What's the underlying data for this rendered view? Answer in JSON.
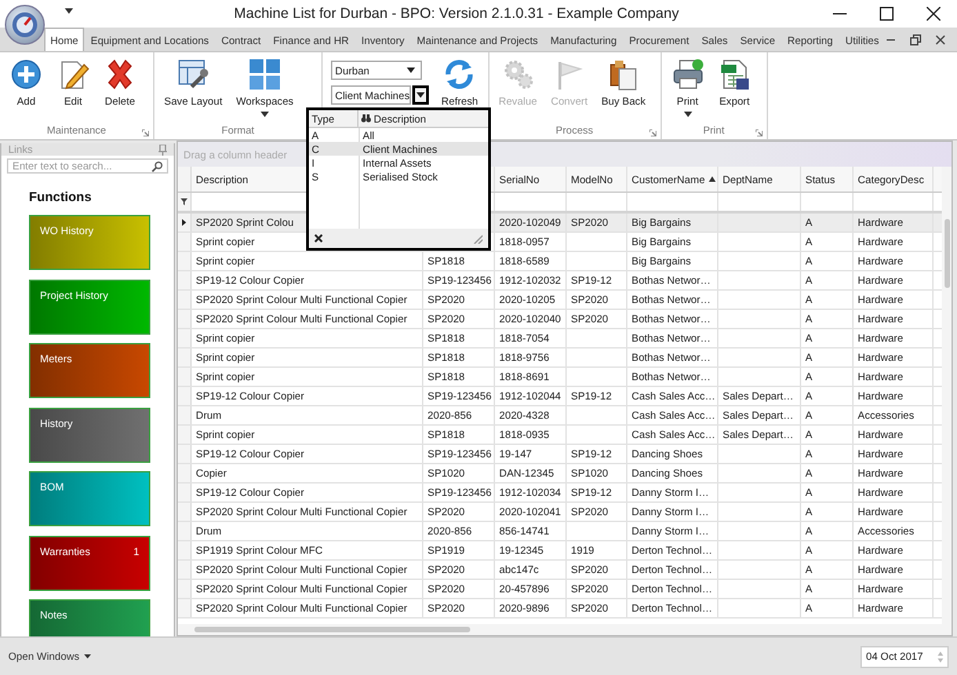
{
  "window": {
    "title": "Machine List for Durban - BPO: Version 2.1.0.31 - Example Company"
  },
  "tabs": [
    {
      "label": "Home",
      "selected": true
    },
    {
      "label": "Equipment and Locations",
      "selected": false
    },
    {
      "label": "Contract",
      "selected": false
    },
    {
      "label": "Finance and HR",
      "selected": false
    },
    {
      "label": "Inventory",
      "selected": false
    },
    {
      "label": "Maintenance and Projects",
      "selected": false
    },
    {
      "label": "Manufacturing",
      "selected": false
    },
    {
      "label": "Procurement",
      "selected": false
    },
    {
      "label": "Sales",
      "selected": false
    },
    {
      "label": "Service",
      "selected": false
    },
    {
      "label": "Reporting",
      "selected": false
    },
    {
      "label": "Utilities",
      "selected": false
    }
  ],
  "ribbon": {
    "groups": [
      {
        "label": "Maintenance",
        "items": [
          {
            "kind": "button",
            "label": "Add",
            "disabled": false
          },
          {
            "kind": "button",
            "label": "Edit",
            "disabled": false
          },
          {
            "kind": "button",
            "label": "Delete",
            "disabled": false
          }
        ]
      },
      {
        "label": "Format",
        "items": [
          {
            "kind": "button",
            "label": "Save Layout",
            "disabled": false
          },
          {
            "kind": "menu_button",
            "label": "Workspaces",
            "disabled": false
          }
        ]
      },
      {
        "items": [
          {
            "kind": "combos",
            "combos": [
              {
                "value": "Durban",
                "open": false
              },
              {
                "value": "Client Machines",
                "open": true
              }
            ]
          },
          {
            "kind": "button",
            "label": "Refresh",
            "disabled": false
          }
        ]
      },
      {
        "label": "Process",
        "items": [
          {
            "kind": "button",
            "label": "Revalue",
            "disabled": true
          },
          {
            "kind": "button",
            "label": "Convert",
            "disabled": true
          },
          {
            "kind": "button",
            "label": "Buy Back",
            "disabled": false
          }
        ]
      },
      {
        "label": "Print",
        "items": [
          {
            "kind": "menu_button",
            "label": "Print",
            "disabled": false
          },
          {
            "kind": "button",
            "label": "Export",
            "disabled": false
          }
        ]
      }
    ]
  },
  "links": {
    "title": "Links",
    "search": {
      "placeholder": "Enter text to search..."
    },
    "heading": "Functions",
    "tiles": [
      {
        "label": "WO History",
        "color": "#c8c000"
      },
      {
        "label": "Project History",
        "color": "#00b800"
      },
      {
        "label": "Meters",
        "color": "#c84800"
      },
      {
        "label": "History",
        "color": "#707070"
      },
      {
        "label": "BOM",
        "color": "#00c0c0"
      },
      {
        "label": "Warranties",
        "color": "#c80000",
        "count": "1"
      },
      {
        "label": "Notes",
        "color": "#20a050"
      }
    ]
  },
  "grid": {
    "group_panel": "Drag a column header",
    "columns": [
      {
        "label": "Description",
        "sorted": false
      },
      {},
      {
        "label": "SerialNo",
        "sorted": false
      },
      {
        "label": "ModelNo",
        "sorted": false
      },
      {
        "label": "CustomerName",
        "sorted": true
      },
      {
        "label": "DeptName",
        "sorted": false
      },
      {
        "label": "Status",
        "sorted": false
      },
      {
        "label": "CategoryDesc",
        "sorted": false
      }
    ],
    "rows": [
      {
        "selected": true,
        "cells": [
          "SP2020 Sprint Colou",
          null,
          "2020-102049",
          "SP2020",
          "Big Bargains",
          null,
          "A",
          "Hardware"
        ]
      },
      {
        "selected": false,
        "cells": [
          "Sprint copier",
          null,
          "1818-0957",
          null,
          "Big Bargains",
          null,
          "A",
          "Hardware"
        ]
      },
      {
        "selected": false,
        "cells": [
          "Sprint copier",
          "SP1818",
          "1818-6589",
          null,
          "Big Bargains",
          null,
          "A",
          "Hardware"
        ]
      },
      {
        "selected": false,
        "cells": [
          "SP19-12 Colour Copier",
          "SP19-123456",
          "1912-102032",
          "SP19-12",
          "Bothas Networ…",
          null,
          "A",
          "Hardware"
        ]
      },
      {
        "selected": false,
        "cells": [
          "SP2020 Sprint Colour Multi Functional Copier",
          "SP2020",
          "2020-10205",
          "SP2020",
          "Bothas Networ…",
          null,
          "A",
          "Hardware"
        ]
      },
      {
        "selected": false,
        "cells": [
          "SP2020 Sprint Colour Multi Functional Copier",
          "SP2020",
          "2020-102040",
          "SP2020",
          "Bothas Networ…",
          null,
          "A",
          "Hardware"
        ]
      },
      {
        "selected": false,
        "cells": [
          "Sprint copier",
          "SP1818",
          "1818-7054",
          null,
          "Bothas Networ…",
          null,
          "A",
          "Hardware"
        ]
      },
      {
        "selected": false,
        "cells": [
          "Sprint copier",
          "SP1818",
          "1818-9756",
          null,
          "Bothas Networ…",
          null,
          "A",
          "Hardware"
        ]
      },
      {
        "selected": false,
        "cells": [
          "Sprint copier",
          "SP1818",
          "1818-8691",
          null,
          "Bothas Networ…",
          null,
          "A",
          "Hardware"
        ]
      },
      {
        "selected": false,
        "cells": [
          "SP19-12 Colour Copier",
          "SP19-123456",
          "1912-102044",
          "SP19-12",
          "Cash Sales Acc…",
          "Sales Depart…",
          "A",
          "Hardware"
        ]
      },
      {
        "selected": false,
        "cells": [
          "Drum",
          "2020-856",
          "2020-4328",
          null,
          "Cash Sales Acc…",
          "Sales Depart…",
          "A",
          "Accessories"
        ]
      },
      {
        "selected": false,
        "cells": [
          "Sprint copier",
          "SP1818",
          "1818-0935",
          null,
          "Cash Sales Acc…",
          "Sales Depart…",
          "A",
          "Hardware"
        ]
      },
      {
        "selected": false,
        "cells": [
          "SP19-12 Colour Copier",
          "SP19-123456",
          "19-147",
          "SP19-12",
          "Dancing Shoes",
          null,
          "A",
          "Hardware"
        ]
      },
      {
        "selected": false,
        "cells": [
          "Copier",
          "SP1020",
          "DAN-12345",
          "SP1020",
          "Dancing Shoes",
          null,
          "A",
          "Hardware"
        ]
      },
      {
        "selected": false,
        "cells": [
          "SP19-12 Colour Copier",
          "SP19-123456",
          "1912-102034",
          "SP19-12",
          "Danny Storm I…",
          null,
          "A",
          "Hardware"
        ]
      },
      {
        "selected": false,
        "cells": [
          "SP2020 Sprint Colour Multi Functional Copier",
          "SP2020",
          "2020-102041",
          "SP2020",
          "Danny Storm I…",
          null,
          "A",
          "Hardware"
        ]
      },
      {
        "selected": false,
        "cells": [
          "Drum",
          "2020-856",
          "856-14741",
          null,
          "Danny Storm I…",
          null,
          "A",
          "Accessories"
        ]
      },
      {
        "selected": false,
        "cells": [
          "SP1919 Sprint Colour MFC",
          "SP1919",
          "19-12345",
          "1919",
          "Derton Technol…",
          null,
          "A",
          "Hardware"
        ]
      },
      {
        "selected": false,
        "cells": [
          "SP2020 Sprint Colour Multi Functional Copier",
          "SP2020",
          "abc147c",
          "SP2020",
          "Derton Technol…",
          null,
          "A",
          "Hardware"
        ]
      },
      {
        "selected": false,
        "cells": [
          "SP2020 Sprint Colour Multi Functional Copier",
          "SP2020",
          "20-457896",
          "SP2020",
          "Derton Technol…",
          null,
          "A",
          "Hardware"
        ]
      },
      {
        "selected": false,
        "cells": [
          "SP2020 Sprint Colour Multi Functional Copier",
          "SP2020",
          "2020-9896",
          "SP2020",
          "Derton Technol…",
          null,
          "A",
          "Hardware"
        ]
      }
    ]
  },
  "type_dropdown": {
    "columns": [
      "Type",
      "Description"
    ],
    "rows": [
      {
        "type": "A",
        "description": "All",
        "selected": false
      },
      {
        "type": "C",
        "description": "Client Machines",
        "selected": true
      },
      {
        "type": "I",
        "description": "Internal Assets",
        "selected": false
      },
      {
        "type": "S",
        "description": "Serialised Stock",
        "selected": false
      }
    ]
  },
  "status_bar": {
    "open_windows": "Open Windows",
    "date": "04 Oct 2017"
  }
}
